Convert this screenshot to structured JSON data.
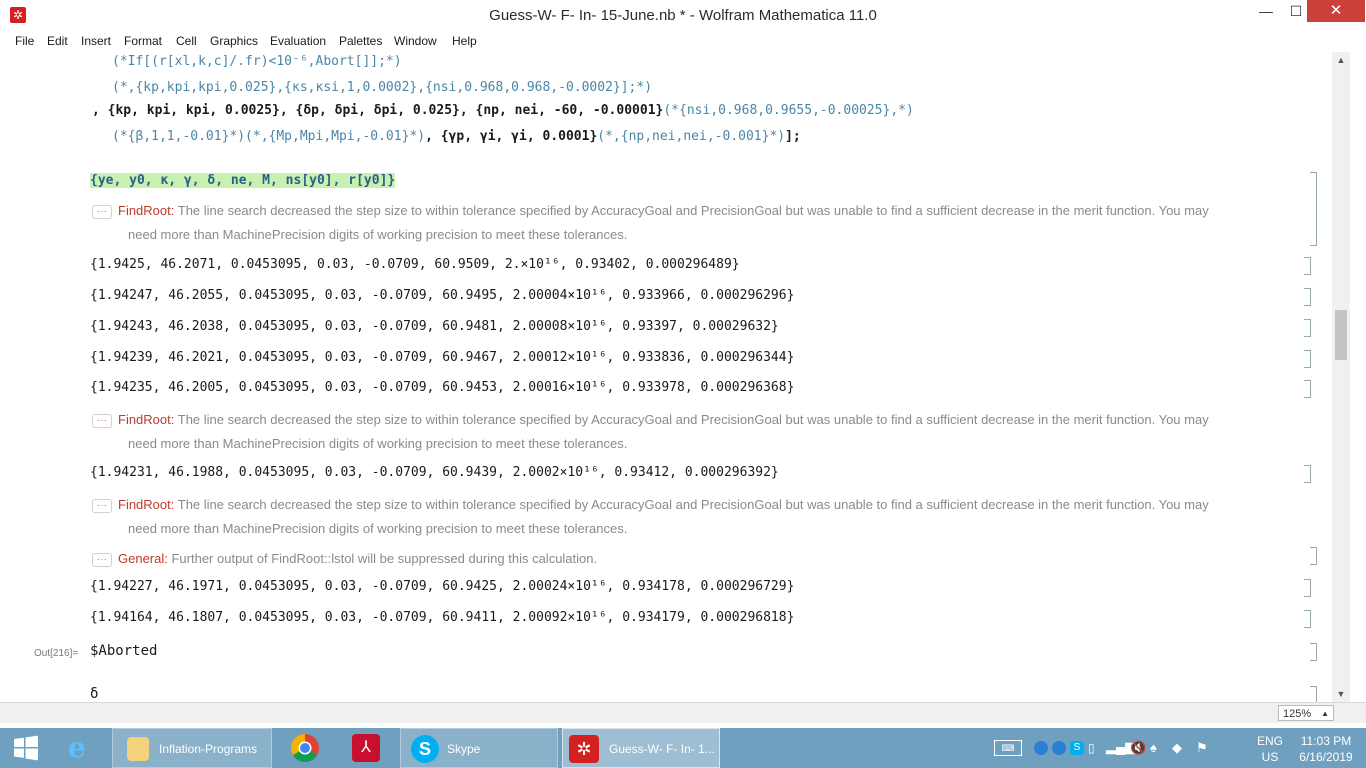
{
  "window": {
    "title": "Guess-W- F- In- 15-June.nb * - Wolfram Mathematica 11.0",
    "app_icon": "mathematica-icon",
    "min": "—",
    "max": "☐",
    "close": "✕"
  },
  "menu": [
    "File",
    "Edit",
    "Insert",
    "Format",
    "Cell",
    "Graphics",
    "Evaluation",
    "Palettes",
    "Window",
    "Help"
  ],
  "input": {
    "line1_comment": "(*If[(r[xl,k,c]/.fr)<10⁻⁶,Abort[]];*)",
    "line2_comment": "(*,{kp,kpi,kpi,0.025},{κs,κsi,1,0.0002},{nsi,0.968,0.968,-0.0002}];*)",
    "line3_code": ", {kp, kpi, kpi, 0.0025}, {δp, δpi, δpi, 0.025}, {np, nei, -60, -0.00001}",
    "line3_comment": "(*{nsi,0.968,0.9655,-0.00025},*)",
    "line4_comment1": "(*{β,1,1,-0.01}*)(*,{Mp,Mpi,Mpi,-0.01}*)",
    "line4_code": ", {γp, γi, γi, 0.0001}",
    "line4_comment2": "(*,{np,nei,nei,-0.001}*)",
    "line4_end": "];",
    "print_line": "{ye, y0, κ, γ, δ, ne, M, ns[y0], r[y0]}"
  },
  "messages": {
    "dots": "···",
    "findroot_symbol": "FindRoot",
    "findroot_line1": "The line search decreased the step size to within tolerance specified by AccuracyGoal and PrecisionGoal but was unable to find a sufficient decrease in the merit function. You may",
    "findroot_line2": "need more than MachinePrecision digits of working precision to meet these tolerances.",
    "general_symbol": "General",
    "general_text1": "Further output of ",
    "general_link": "FindRoot::lstol",
    "general_text2": " will be suppressed during this calculation."
  },
  "outputs": [
    "{1.9425, 46.2071, 0.0453095, 0.03, -0.0709, 60.9509, 2.×10¹⁶, 0.93402, 0.000296489}",
    "{1.94247, 46.2055, 0.0453095, 0.03, -0.0709, 60.9495, 2.00004×10¹⁶, 0.933966, 0.000296296}",
    "{1.94243, 46.2038, 0.0453095, 0.03, -0.0709, 60.9481, 2.00008×10¹⁶, 0.93397, 0.00029632}",
    "{1.94239, 46.2021, 0.0453095, 0.03, -0.0709, 60.9467, 2.00012×10¹⁶, 0.933836, 0.000296344}",
    "{1.94235, 46.2005, 0.0453095, 0.03, -0.0709, 60.9453, 2.00016×10¹⁶, 0.933978, 0.000296368}",
    "{1.94231, 46.1988, 0.0453095, 0.03, -0.0709, 60.9439, 2.0002×10¹⁶, 0.93412, 0.000296392}",
    "{1.94227, 46.1971, 0.0453095, 0.03, -0.0709, 60.9425, 2.00024×10¹⁶, 0.934178, 0.000296729}",
    "{1.94164, 46.1807, 0.0453095, 0.03, -0.0709, 60.9411, 2.00092×10¹⁶, 0.934179, 0.000296818}"
  ],
  "out_label": "Out[216]=",
  "aborted": "$Aborted",
  "next_input": "δ",
  "status": {
    "zoom": "125%"
  },
  "taskbar": {
    "apps": [
      {
        "label": "Inflation-Programs"
      },
      {
        "label": "Skype"
      },
      {
        "label": "Guess-W- F- In- 1..."
      }
    ],
    "lang": "ENG",
    "region": "US",
    "time": "11:03 PM",
    "date": "6/16/2019"
  },
  "colors": {
    "taskbar": "#6fa0bf",
    "close": "#c9413a",
    "message_symbol": "#c0392b",
    "comment": "#4a86a8"
  }
}
